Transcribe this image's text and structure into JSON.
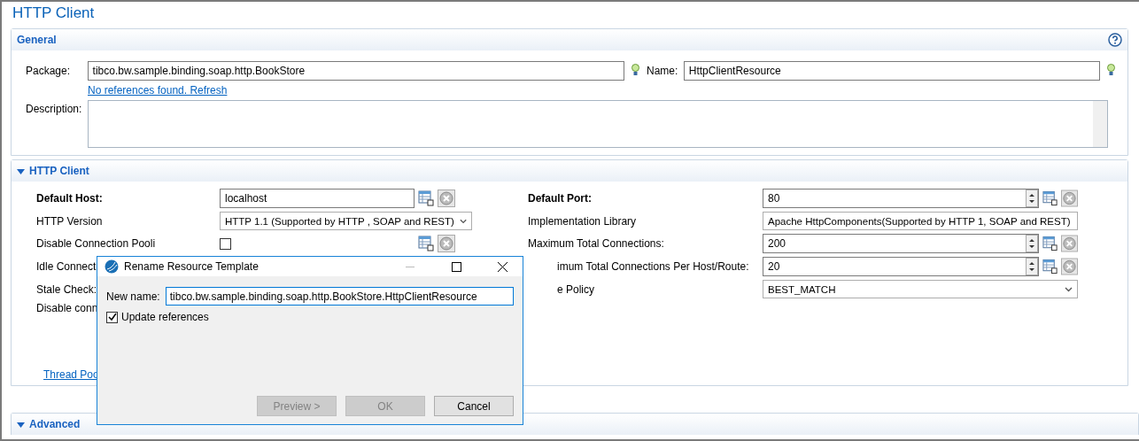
{
  "page_title": "HTTP Client",
  "general": {
    "title": "General",
    "package_label": "Package:",
    "package": "tibco.bw.sample.binding.soap.http.BookStore",
    "name_label": "Name:",
    "name": "HttpClientResource",
    "link": "No references found. Refresh",
    "description_label": "Description:"
  },
  "http_client": {
    "title": "HTTP Client",
    "expanded": true,
    "left_rows": [
      {
        "label": "Default Host:",
        "bold": true,
        "kind": "text",
        "value": "localhost"
      },
      {
        "label": "HTTP Version",
        "bold": false,
        "kind": "select",
        "value": "HTTP 1.1 (Supported by HTTP , SOAP and REST)"
      },
      {
        "label": "Disable Connection Pooli",
        "bold": false,
        "kind": "checkbox",
        "checked": false
      },
      {
        "label": "Idle Connect",
        "bold": false,
        "kind": "none"
      },
      {
        "label": "Stale Check:",
        "bold": false,
        "kind": "none"
      },
      {
        "label": "Disable conn",
        "bold": false,
        "kind": "none"
      }
    ],
    "right_rows": [
      {
        "label": "Default Port:",
        "bold": true,
        "clipped": false,
        "kind": "spinner",
        "value": "80"
      },
      {
        "label": "Implementation Library",
        "bold": false,
        "clipped": false,
        "kind": "select",
        "value": "Apache HttpComponents(Supported by HTTP 1, SOAP and REST)"
      },
      {
        "label": "Maximum Total Connections:",
        "bold": false,
        "clipped": false,
        "kind": "spinner",
        "value": "200"
      },
      {
        "label": "imum Total Connections Per Host/Route:",
        "bold": false,
        "clipped": true,
        "kind": "spinner",
        "value": "20"
      },
      {
        "label": "e Policy",
        "bold": false,
        "clipped": true,
        "kind": "select",
        "value": "BEST_MATCH"
      }
    ],
    "link": "Thread Poo"
  },
  "advanced": {
    "title": "Advanced",
    "expanded": true
  },
  "dialog": {
    "title": "Rename Resource Template",
    "name_label": "New name:",
    "name": "tibco.bw.sample.binding.soap.http.BookStore.HttpClientResource",
    "update_label": "Update references",
    "update_checked": true,
    "buttons": [
      {
        "label": "Preview >",
        "disabled": true
      },
      {
        "label": "OK",
        "disabled": true
      },
      {
        "label": "Cancel",
        "disabled": false
      }
    ]
  }
}
